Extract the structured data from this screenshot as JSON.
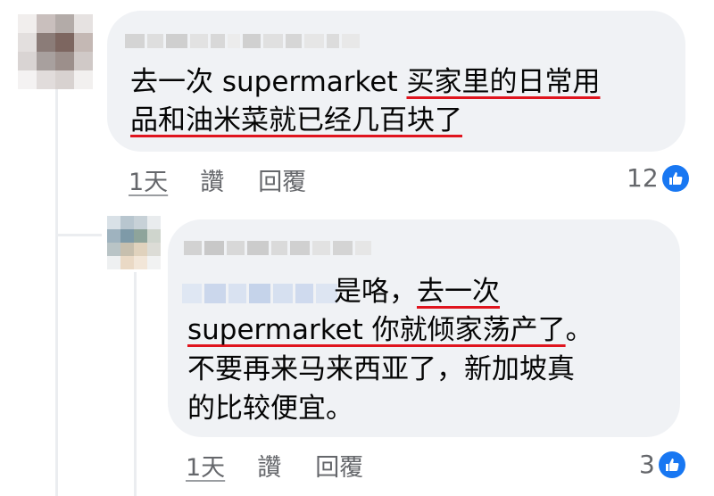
{
  "comment1": {
    "line1_prefix": "去一次 supermarket ",
    "line1_highlight": "买家里的日常用",
    "line2_highlight": "品和油米菜就已经几百块了",
    "time": "1天",
    "like": "讚",
    "reply": "回覆",
    "reaction_count": "12"
  },
  "comment2": {
    "line1_text": "是咯，",
    "line1_highlight": "去一次",
    "line2_highlight": "supermarket 你就倾家荡产了",
    "line2_tail": "。",
    "line3": "不要再来马来西亚了，新加坡真",
    "line4": "的比较便宜。",
    "time": "1天",
    "like": "讚",
    "reply": "回覆",
    "reaction_count": "3"
  },
  "colors": {
    "bubble": "#f0f2f5",
    "underline": "#e0141e",
    "like_badge": "#1877f2",
    "meta_text": "#65676b"
  },
  "icons": {
    "reaction": "thumbs-up-icon"
  }
}
